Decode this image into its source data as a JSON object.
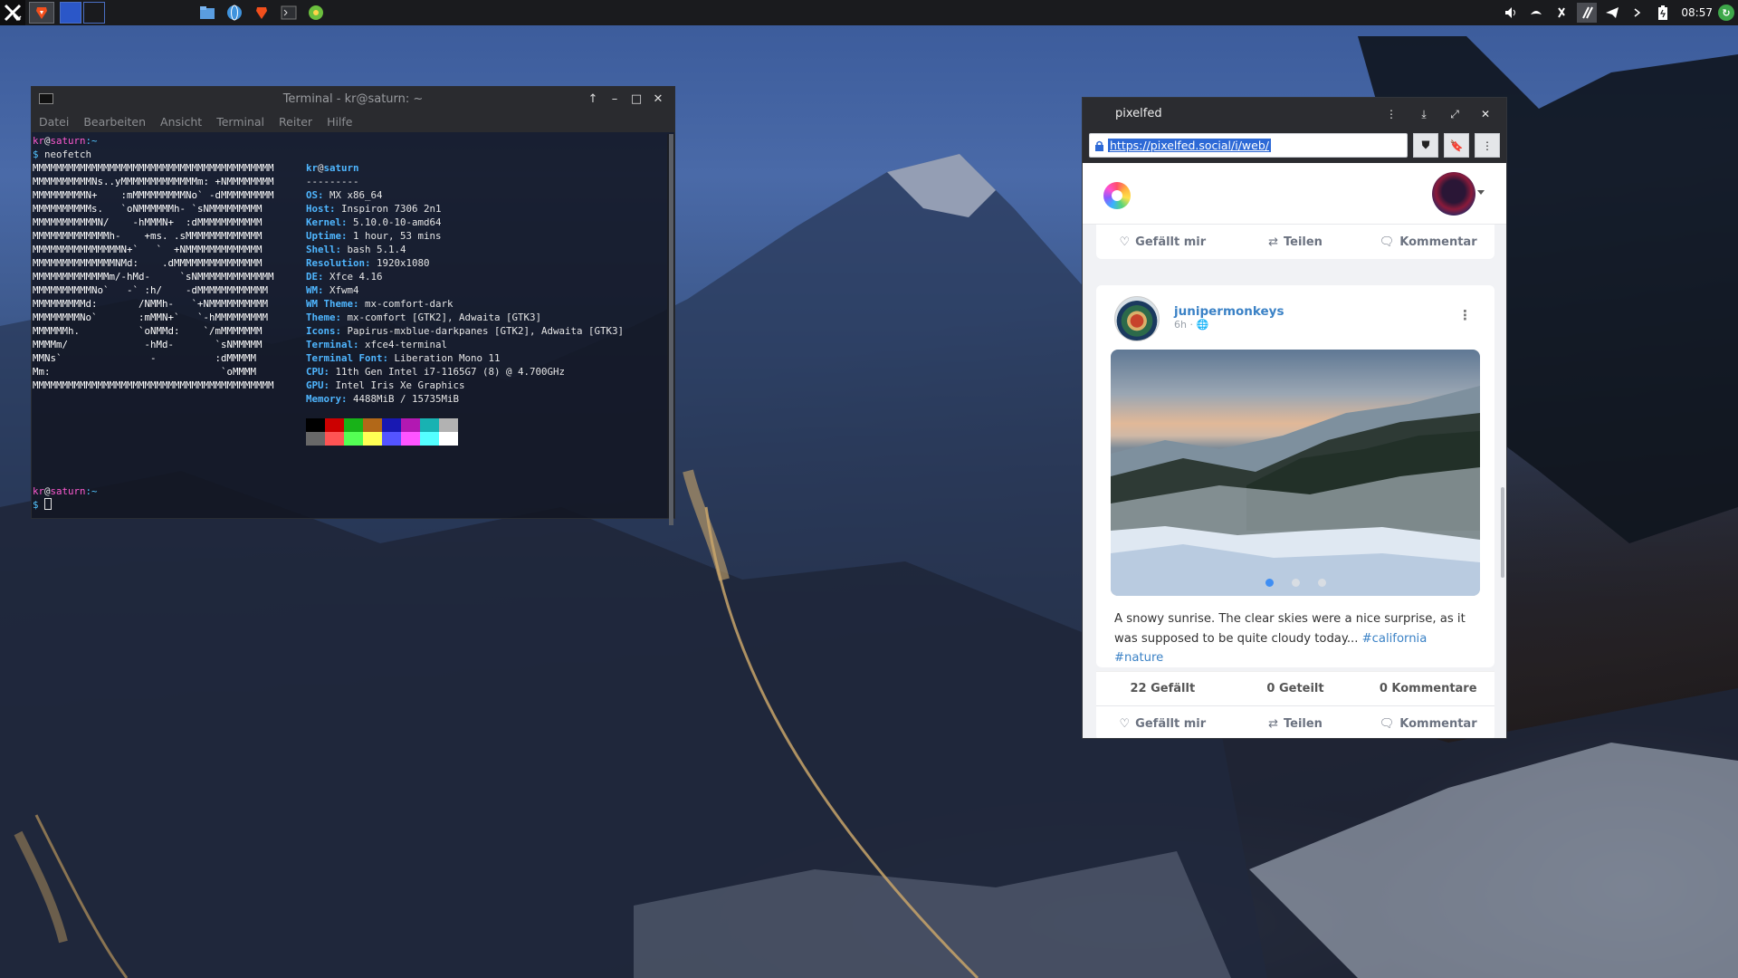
{
  "taskbar": {
    "clock": "08:57"
  },
  "terminal": {
    "title": "Terminal - kr@saturn: ~",
    "menu": [
      "Datei",
      "Bearbeiten",
      "Ansicht",
      "Terminal",
      "Reiter",
      "Hilfe"
    ],
    "prompt_user": "kr",
    "prompt_host": "saturn",
    "prompt_path": ":~",
    "command": "neofetch",
    "ascii": [
      "MMMMMMMMMMMMMMMMMMMMMMMMMMMMMMMMMMMMMMMMM",
      "MMMMMMMMMMNs..yMMMMMMMMMMMMMm: +NMMMMMMMM",
      "MMMMMMMMMN+    :mMMMMMMMMMNo` -dMMMMMMMMM",
      "MMMMMMMMMMs.   `oNMMMMMMh- `sNMMMMMMMMM",
      "MMMMMMMMMMMN/    -hMMMN+  :dMMMMMMMMMMM",
      "MMMMMMMMMMMMMh-    +ms. .sMMMMMMMMMMMMM",
      "MMMMMMMMMMMMMMMN+`   `  +NMMMMMMMMMMMMM",
      "MMMMMMMMMMMMMMNMd:    .dMMMMMMMMMMMMMMM",
      "MMMMMMMMMMMMMm/-hMd-     `sNMMMMMMMMMMMMM",
      "MMMMMMMMMMNo`   -` :h/    -dMMMMMMMMMMMM",
      "MMMMMMMMMd:       /NMMh-   `+NMMMMMMMMMM",
      "MMMMMMMMNo`       :mMMN+`   `-hMMMMMMMMM",
      "MMMMMMh.          `oNMMd:    `/mMMMMMMM",
      "MMMMm/             -hMd-       `sNMMMMM",
      "MMNs`               -          :dMMMMM",
      "Mm:                             `oMMMM",
      "MMMMMMMMMMMMMMMMMMMMMMMMMMMMMMMMMMMMMMMMM"
    ],
    "info_user": "kr",
    "info_host": "saturn",
    "info_sep": "---------",
    "info": [
      {
        "k": "OS",
        "v": "MX x86_64"
      },
      {
        "k": "Host",
        "v": "Inspiron 7306 2n1"
      },
      {
        "k": "Kernel",
        "v": "5.10.0-10-amd64"
      },
      {
        "k": "Uptime",
        "v": "1 hour, 53 mins"
      },
      {
        "k": "Shell",
        "v": "bash 5.1.4"
      },
      {
        "k": "Resolution",
        "v": "1920x1080"
      },
      {
        "k": "DE",
        "v": "Xfce 4.16"
      },
      {
        "k": "WM",
        "v": "Xfwm4"
      },
      {
        "k": "WM Theme",
        "v": "mx-comfort-dark"
      },
      {
        "k": "Theme",
        "v": "mx-comfort [GTK2], Adwaita [GTK3]"
      },
      {
        "k": "Icons",
        "v": "Papirus-mxblue-darkpanes [GTK2], Adwaita [GTK3]"
      },
      {
        "k": "Terminal",
        "v": "xfce4-terminal"
      },
      {
        "k": "Terminal Font",
        "v": "Liberation Mono 11"
      },
      {
        "k": "CPU",
        "v": "11th Gen Intel i7-1165G7 (8) @ 4.700GHz"
      },
      {
        "k": "GPU",
        "v": "Intel Iris Xe Graphics"
      },
      {
        "k": "Memory",
        "v": "4488MiB / 15735MiB"
      }
    ],
    "palette": [
      "#000000",
      "#cc0000",
      "#18b218",
      "#b26818",
      "#1818b2",
      "#b218b2",
      "#18b2b2",
      "#b2b2b2",
      "#686868",
      "#ff5454",
      "#54ff54",
      "#ffff54",
      "#5454ff",
      "#ff54ff",
      "#54ffff",
      "#ffffff"
    ]
  },
  "pixelfed": {
    "title": "pixelfed",
    "url": "https://pixelfed.social/i/web/",
    "like_label": "Gefällt mir",
    "share_label": "Teilen",
    "comment_label": "Kommentar",
    "post": {
      "username": "junipermonkeys",
      "time": "6h",
      "caption": "A snowy sunrise. The clear skies were a nice surprise, as it was supposed to be quite cloudy today...",
      "tag1": "#california",
      "tag2": "#nature",
      "likes": "22 Gefällt",
      "shares": "0 Geteilt",
      "comments": "0 Kommentare"
    }
  }
}
